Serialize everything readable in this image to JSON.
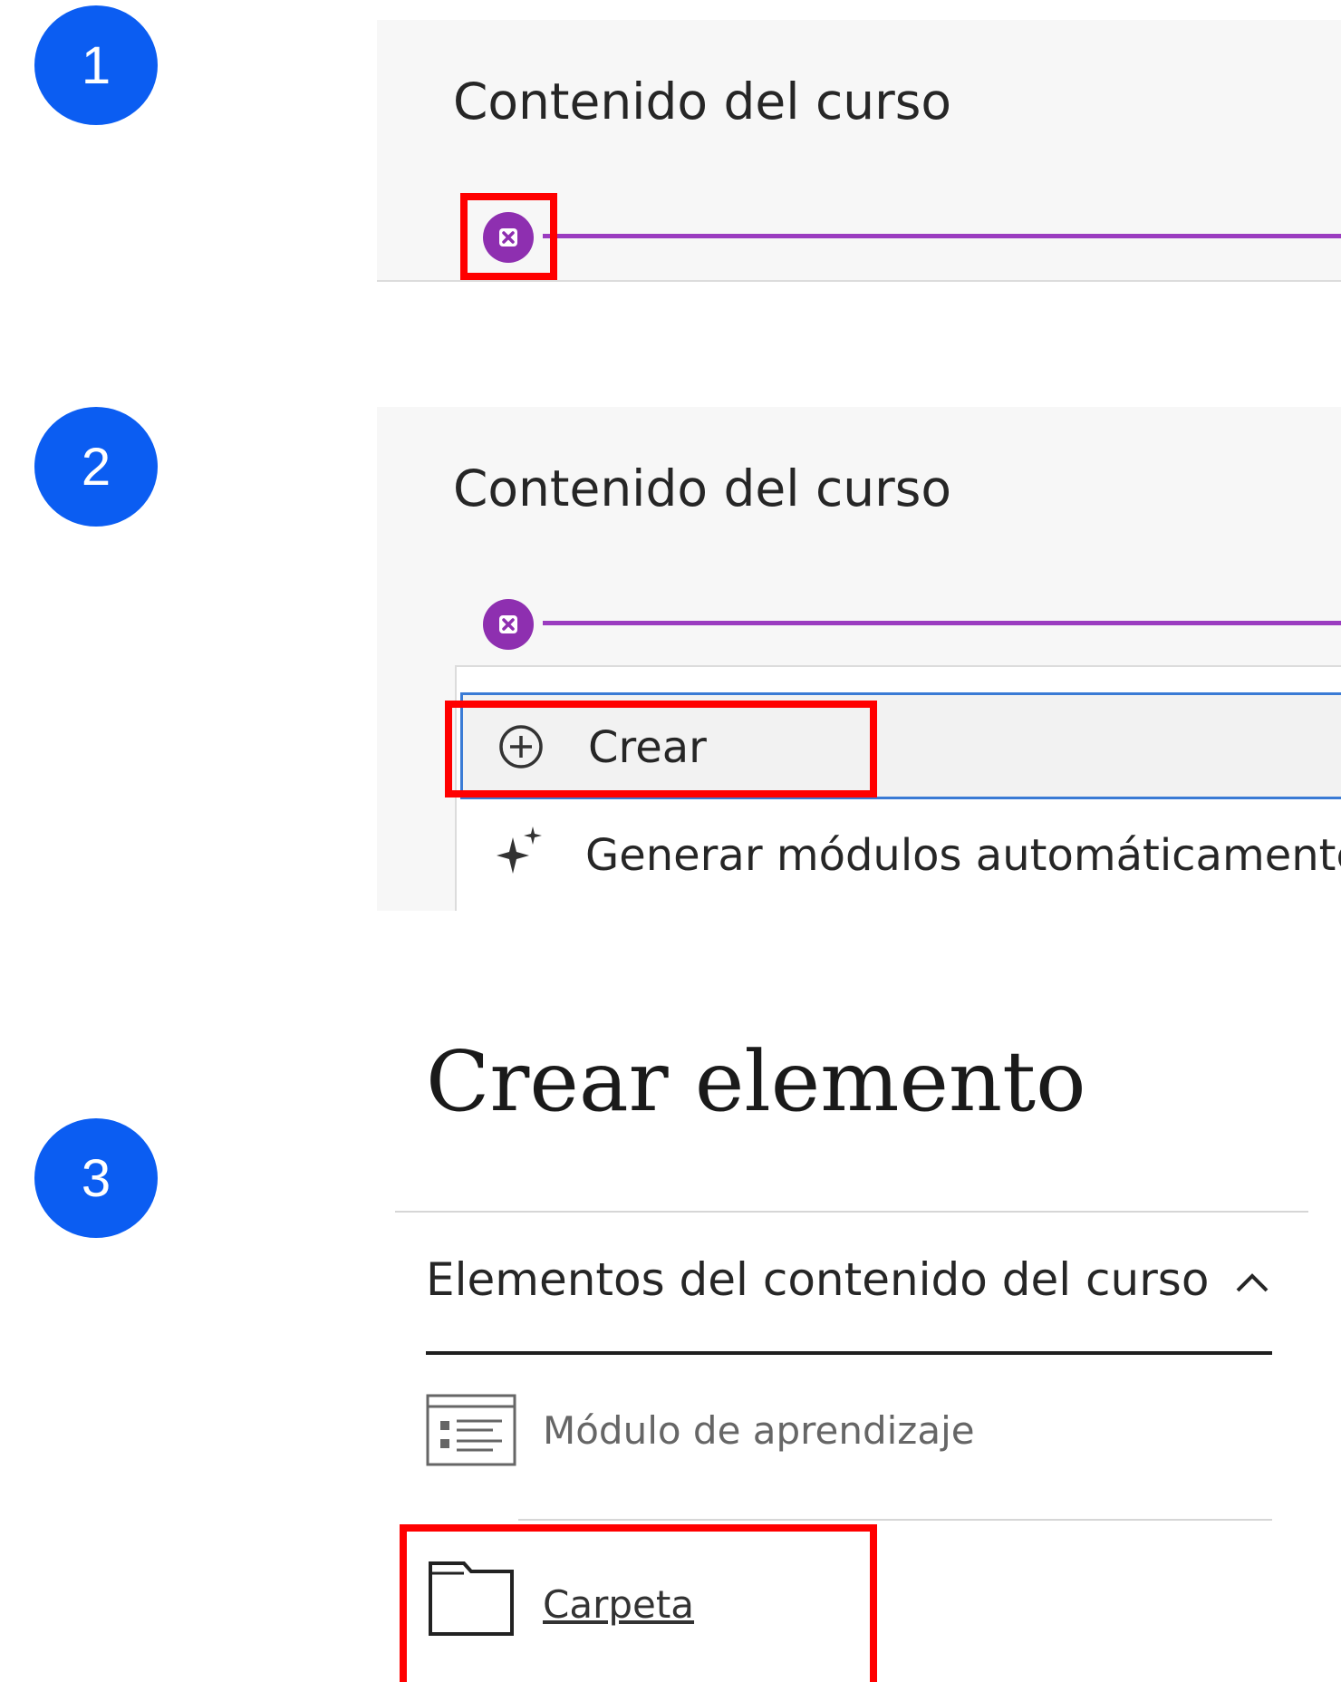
{
  "steps": [
    "1",
    "2",
    "3"
  ],
  "panel1": {
    "title": "Contenido del curso"
  },
  "panel2": {
    "title": "Contenido del curso",
    "menu": [
      {
        "label": "Crear",
        "icon": "plus-circle-icon"
      },
      {
        "label": "Generar módulos automáticamente",
        "icon": "sparkle-icon"
      }
    ]
  },
  "panel3": {
    "heading": "Crear elemento",
    "section": "Elementos del contenido del curso",
    "items": [
      {
        "label": "Módulo de aprendizaje",
        "icon": "learning-module-icon"
      },
      {
        "label": "Carpeta",
        "icon": "folder-icon"
      }
    ]
  },
  "colors": {
    "step_badge": "#0b5df2",
    "add_accent": "#8e2fb0",
    "highlight": "#ff0000",
    "menu_focus": "#3a7bd5"
  }
}
